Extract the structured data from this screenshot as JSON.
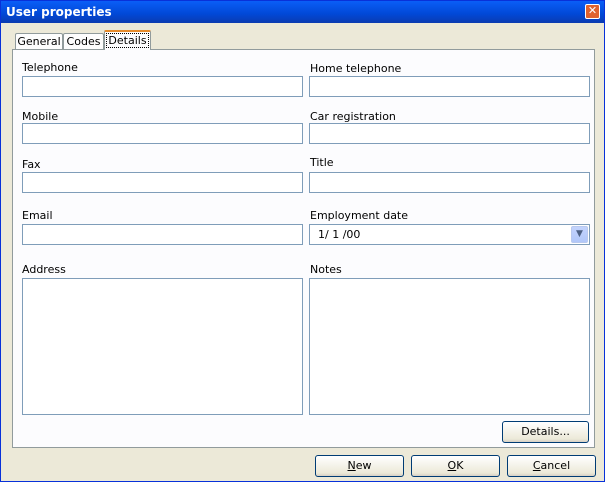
{
  "window": {
    "title": "User properties"
  },
  "tabs": [
    {
      "label": "General"
    },
    {
      "label": "Codes"
    },
    {
      "label": "Details",
      "active": true
    }
  ],
  "fields": {
    "telephone": {
      "label": "Telephone",
      "value": ""
    },
    "home_telephone": {
      "label": "Home telephone",
      "value": ""
    },
    "mobile": {
      "label": "Mobile",
      "value": ""
    },
    "car_registration": {
      "label": "Car registration",
      "value": ""
    },
    "fax": {
      "label": "Fax",
      "value": ""
    },
    "title": {
      "label": "Title",
      "value": ""
    },
    "email": {
      "label": "Email",
      "value": ""
    },
    "employment_date": {
      "label": "Employment date",
      "value": "1/ 1 /00"
    },
    "address": {
      "label": "Address",
      "value": ""
    },
    "notes": {
      "label": "Notes",
      "value": ""
    }
  },
  "buttons": {
    "details_label": "Details...",
    "new_mnemonic": "N",
    "new_rest": "ew",
    "ok_mnemonic": "O",
    "ok_rest": "K",
    "cancel_mnemonic": "C",
    "cancel_rest": "ancel"
  },
  "icons": {
    "close": "close-icon",
    "dropdown": "chevron-down-icon"
  },
  "colors": {
    "titlebar": "#0148d6",
    "dialog_bg": "#ece9d8",
    "tab_highlight": "#e68b2c",
    "input_border": "#7f9db9"
  }
}
